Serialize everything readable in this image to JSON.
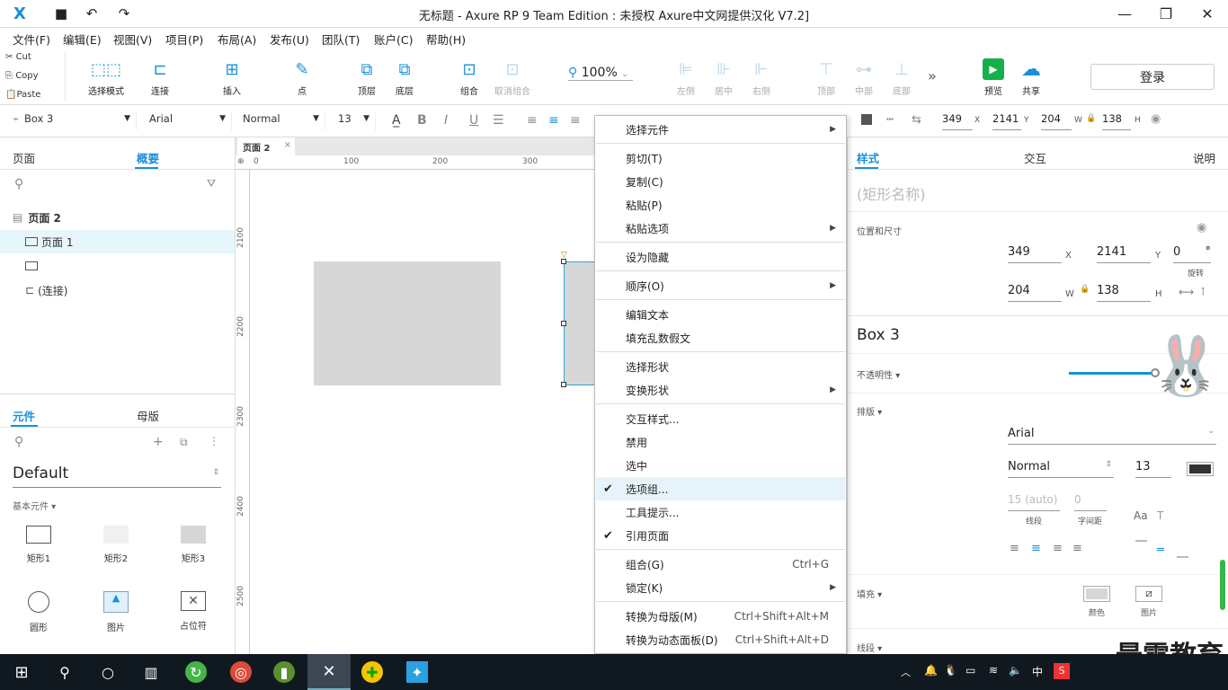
{
  "window": {
    "title": "无标题 - Axure RP 9 Team Edition : 未授权    Axure中文网提供汉化 V7.2]"
  },
  "menu": [
    "文件(F)",
    "编辑(E)",
    "视图(V)",
    "项目(P)",
    "布局(A)",
    "发布(U)",
    "团队(T)",
    "账户(C)",
    "帮助(H)"
  ],
  "clipboard": {
    "cut": "Cut",
    "copy": "Copy",
    "paste": "Paste"
  },
  "tools": {
    "select_mode": "选择模式",
    "connect": "连接",
    "insert": "插入",
    "point": "点",
    "top_layer": "顶层",
    "bottom_layer": "底层",
    "group": "组合",
    "ungroup": "取消组合",
    "zoom": "100%",
    "align_left": "左侧",
    "align_center": "居中",
    "align_right": "右侧",
    "align_top": "顶部",
    "align_middle": "中部",
    "align_bottom": "底部",
    "preview": "预览",
    "share": "共享",
    "login": "登录"
  },
  "stylebar": {
    "style": "Box 3",
    "font": "Arial",
    "weight": "Normal",
    "size": "13",
    "x": "349",
    "y": "2141",
    "w": "204",
    "h": "138"
  },
  "left": {
    "tabs": [
      "页面",
      "概要"
    ],
    "tree": [
      {
        "label": "页面 2"
      },
      {
        "label": "页面 1"
      },
      {
        "label": ""
      },
      {
        "label": "(连接)"
      }
    ],
    "lib_tabs": [
      "元件",
      "母版"
    ],
    "library": "Default",
    "category": "基本元件",
    "widgets": [
      "矩形1",
      "矩形2",
      "矩形3",
      "圆形",
      "图片",
      "占位符"
    ]
  },
  "canvas": {
    "tab": "页面 2",
    "ruler_h": [
      "0",
      "100",
      "200",
      "300"
    ],
    "ruler_v": [
      "2100",
      "2200",
      "2300",
      "2400",
      "2500"
    ]
  },
  "context_menu": [
    {
      "label": "选择元件",
      "sub": true
    },
    {
      "sep": true
    },
    {
      "label": "剪切(T)"
    },
    {
      "label": "复制(C)"
    },
    {
      "label": "粘贴(P)"
    },
    {
      "label": "粘贴选项",
      "sub": true
    },
    {
      "sep": true
    },
    {
      "label": "设为隐藏"
    },
    {
      "sep": true
    },
    {
      "label": "顺序(O)",
      "sub": true
    },
    {
      "sep": true
    },
    {
      "label": "编辑文本"
    },
    {
      "label": "填充乱数假文"
    },
    {
      "sep": true
    },
    {
      "label": "选择形状"
    },
    {
      "label": "变换形状",
      "sub": true
    },
    {
      "sep": true
    },
    {
      "label": "交互样式..."
    },
    {
      "label": "禁用"
    },
    {
      "label": "选中"
    },
    {
      "label": "选项组...",
      "checked": true,
      "hl": true
    },
    {
      "label": "工具提示..."
    },
    {
      "label": "引用页面",
      "checked": true
    },
    {
      "sep": true
    },
    {
      "label": "组合(G)",
      "shortcut": "Ctrl+G"
    },
    {
      "label": "锁定(K)",
      "sub": true
    },
    {
      "sep": true
    },
    {
      "label": "转换为母版(M)",
      "shortcut": "Ctrl+Shift+Alt+M"
    },
    {
      "label": "转换为动态面板(D)",
      "shortcut": "Ctrl+Shift+Alt+D"
    }
  ],
  "right": {
    "tabs": [
      "样式",
      "交互",
      "说明"
    ],
    "name_placeholder": "(矩形名称)",
    "pos_size": "位置和尺寸",
    "x": "349",
    "y": "2141",
    "rotate": "0",
    "rotate_unit": "°",
    "rotate_label": "旋转",
    "w": "204",
    "h": "138",
    "style_name": "Box 3",
    "opacity": "不透明性",
    "typography": "排版",
    "font": "Arial",
    "weight": "Normal",
    "size": "13",
    "line_spacing": "15 (auto)",
    "letter_spacing": "0",
    "line_label": "线段",
    "char_label": "字间距",
    "fill": "填充",
    "fill_color": "颜色",
    "fill_image": "图片",
    "border": "线段"
  },
  "watermark": "最需教育",
  "taskbar": {
    "ime": "中"
  }
}
